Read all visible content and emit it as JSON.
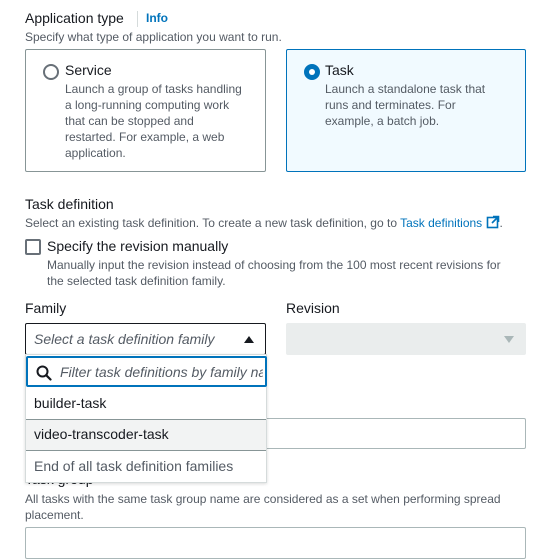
{
  "app_type": {
    "label": "Application type",
    "info": "Info",
    "description": "Specify what type of application you want to run.",
    "options": [
      {
        "title": "Service",
        "lines": [
          "Launch a group of tasks handling",
          "a long-running computing work",
          "that can be stopped and",
          "restarted. For example, a web",
          "application."
        ],
        "selected": false
      },
      {
        "title": "Task",
        "lines": [
          "Launch a standalone task that",
          "runs and terminates. For",
          "example, a batch job."
        ],
        "selected": true
      }
    ]
  },
  "task_def": {
    "label": "Task definition",
    "description_prefix": "Select an existing task definition. To create a new task definition, go to",
    "link": "Task definitions",
    "description_suffix": ".",
    "manual_revision": {
      "label": "Specify the revision manually",
      "checked": false,
      "lines": [
        "Manually input the revision instead of choosing from the 100 most recent revisions for",
        "the selected task definition family."
      ]
    },
    "family": {
      "label": "Family",
      "placeholder": "Select a task definition family",
      "filter_placeholder": "Filter task definitions by family name",
      "options": [
        "builder-task",
        "video-transcoder-task"
      ],
      "footer": "End of all task definition families"
    },
    "revision": {
      "label": "Revision"
    }
  },
  "task_group": {
    "label": "Task group",
    "lines": [
      "All tasks with the same task group name are considered as a set when performing spread",
      "placement."
    ]
  },
  "colors": {
    "accent": "#0073bb",
    "text": "#16191f",
    "muted": "#545b64"
  }
}
